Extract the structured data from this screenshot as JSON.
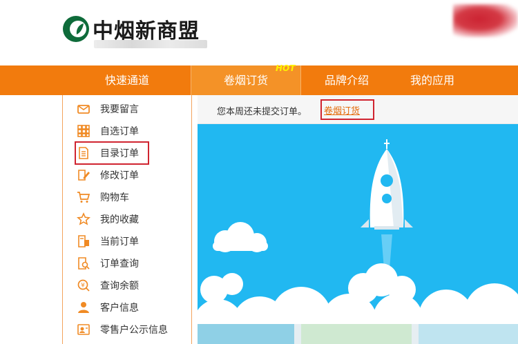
{
  "header": {
    "brand_name": "中烟新商盟",
    "logo_icon": "leaf-c-logo-icon"
  },
  "nav": {
    "items": [
      {
        "label": "快速通道",
        "active": false
      },
      {
        "label": "卷烟订货",
        "active": true,
        "badge": "HOT"
      },
      {
        "label": "品牌介绍",
        "active": false
      },
      {
        "label": "我的应用",
        "active": false
      }
    ]
  },
  "sidebar": {
    "items": [
      {
        "label": "我要留言",
        "icon": "message-icon"
      },
      {
        "label": "自选订单",
        "icon": "grid-order-icon"
      },
      {
        "label": "目录订单",
        "icon": "catalog-document-icon",
        "highlighted": true
      },
      {
        "label": "修改订单",
        "icon": "edit-order-icon"
      },
      {
        "label": "购物车",
        "icon": "shopping-cart-icon"
      },
      {
        "label": "我的收藏",
        "icon": "star-icon"
      },
      {
        "label": "当前订单",
        "icon": "current-order-icon"
      },
      {
        "label": "订单查询",
        "icon": "order-search-icon"
      },
      {
        "label": "查询余额",
        "icon": "balance-icon"
      },
      {
        "label": "客户信息",
        "icon": "user-icon"
      },
      {
        "label": "零售户公示信息",
        "icon": "retailer-info-icon"
      }
    ]
  },
  "notice": {
    "text": "您本周还未提交订单。",
    "link": "卷烟订货"
  },
  "colors": {
    "nav_orange": "#f27b0d",
    "icon_orange": "#f08a24",
    "banner_blue": "#21b8f1",
    "highlight_red": "#d0232f"
  }
}
